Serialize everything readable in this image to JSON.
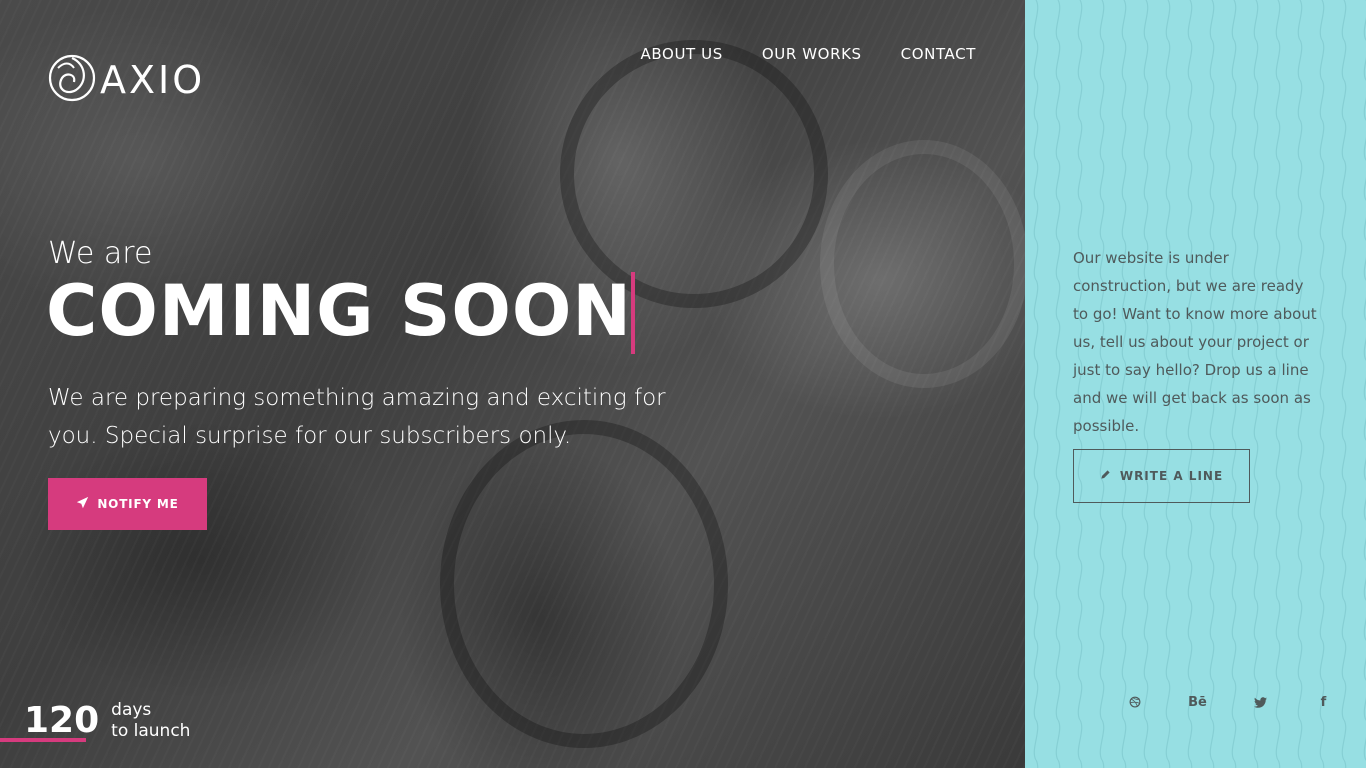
{
  "brand": {
    "name": "AXIO"
  },
  "nav": {
    "items": [
      {
        "label": "ABOUT US"
      },
      {
        "label": "OUR WORKS"
      },
      {
        "label": "CONTACT"
      }
    ]
  },
  "hero": {
    "pretitle": "We are",
    "title": "COMING SOON",
    "subtitle": "We are preparing something amazing and exciting for you. Special surprise for our subscribers only.",
    "notify_label": "NOTIFY ME",
    "notify_icon": "paper-plane-icon"
  },
  "countdown": {
    "number": "120",
    "label_line1": "days",
    "label_line2": "to launch"
  },
  "panel": {
    "text": "Our website is under construction, but we are ready to go! Want to know more about us, tell us about your project or just to say hello? Drop us a line and we will get back as soon as possible.",
    "write_label": "WRITE A LINE",
    "write_icon": "pencil-icon"
  },
  "socials": [
    {
      "icon": "dribbble-icon"
    },
    {
      "icon": "behance-icon",
      "text": "Bē"
    },
    {
      "icon": "twitter-icon"
    },
    {
      "icon": "facebook-icon",
      "text": "f"
    }
  ],
  "colors": {
    "accent": "#d63b7e",
    "panel_bg": "#97dfe3",
    "panel_text": "#4f5a5b",
    "hero_text": "#ffffff"
  }
}
